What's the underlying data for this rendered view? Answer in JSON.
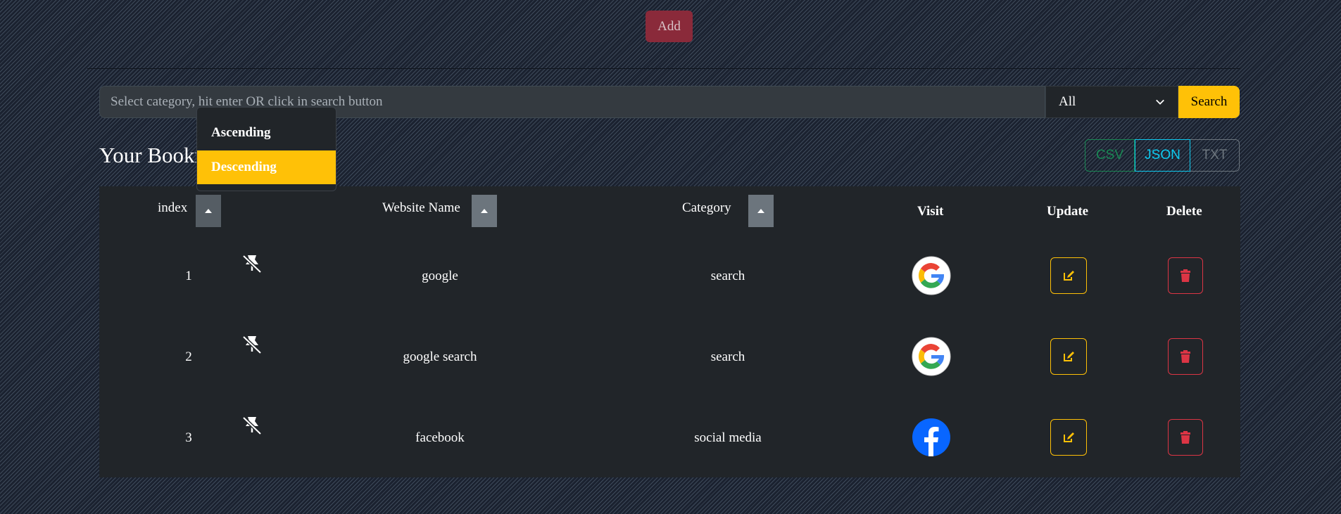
{
  "toolbar": {
    "add_label": "Add"
  },
  "search": {
    "placeholder": "Select category, hit enter OR click in search button",
    "category_value": "All",
    "button_label": "Search"
  },
  "page": {
    "title": "Your Bookmarks"
  },
  "export": {
    "csv": "CSV",
    "json": "JSON",
    "txt": "TXT"
  },
  "sort_menu": {
    "items": [
      "Ascending",
      "Descending"
    ],
    "selected": "Descending"
  },
  "table": {
    "headers": {
      "index": "index",
      "name": "Website Name",
      "category": "Category",
      "visit": "Visit",
      "update": "Update",
      "delete": "Delete"
    },
    "rows": [
      {
        "index": "1",
        "name": "google",
        "category": "search",
        "visit_icon": "google-icon"
      },
      {
        "index": "2",
        "name": "google search",
        "category": "search",
        "visit_icon": "google-icon"
      },
      {
        "index": "3",
        "name": "facebook",
        "category": "social media",
        "visit_icon": "facebook-icon"
      }
    ]
  },
  "colors": {
    "warning": "#ffc107",
    "danger": "#dc3545",
    "info": "#0dcaf0",
    "success": "#198754",
    "panel": "#212529"
  }
}
